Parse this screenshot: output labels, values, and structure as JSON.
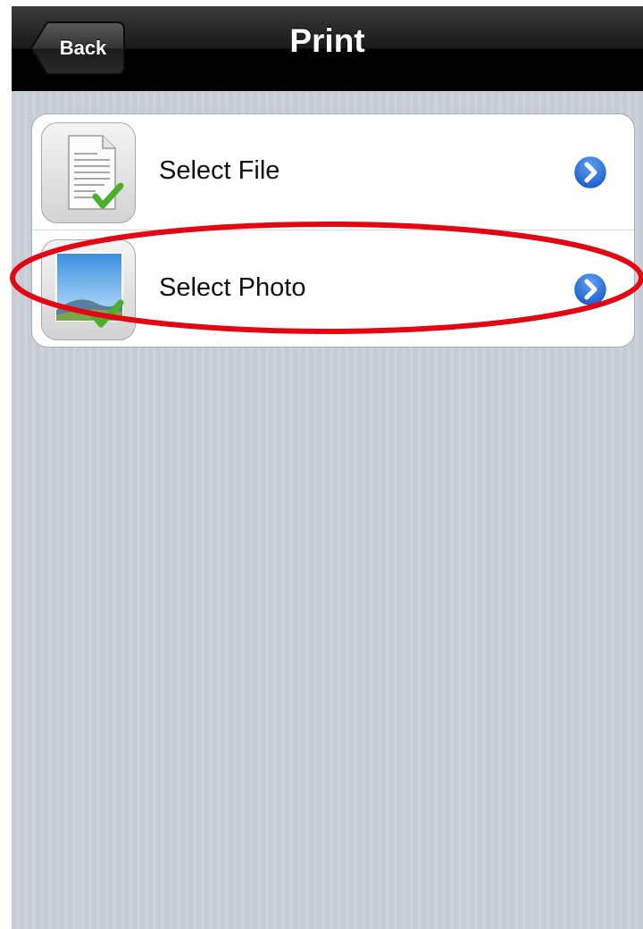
{
  "navbar": {
    "title": "Print",
    "back_label": "Back"
  },
  "menu": {
    "items": [
      {
        "label": "Select File",
        "icon": "document-check-icon"
      },
      {
        "label": "Select Photo",
        "icon": "photo-check-icon"
      }
    ]
  },
  "colors": {
    "navbar": "#000000",
    "background_stripes": "#c8cdd5",
    "disclosure": "#2a6fd8",
    "highlight": "#e30613",
    "check": "#4caf2a"
  }
}
